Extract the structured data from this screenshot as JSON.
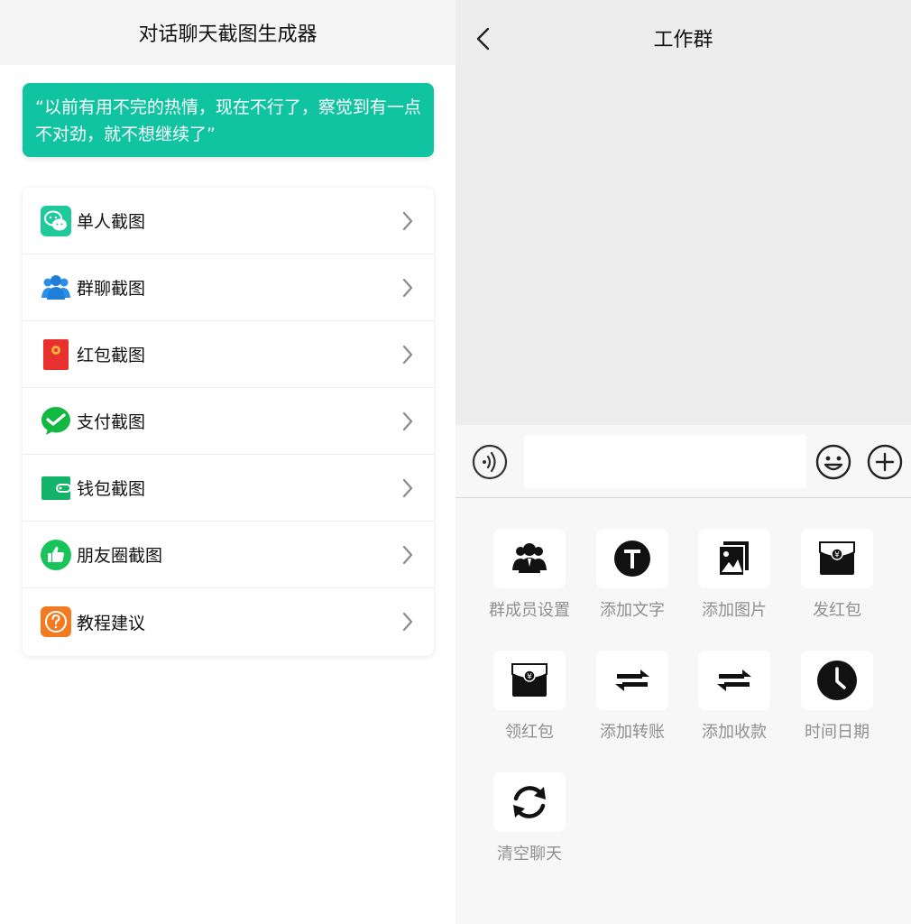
{
  "left": {
    "title": "对话聊天截图生成器",
    "quote": "“以前有用不完的热情，现在不行了，察觉到有一点不对劲，就不想继续了”",
    "menu": [
      {
        "label": "单人截图",
        "icon": "wechat-icon",
        "color": "#1ec99a"
      },
      {
        "label": "群聊截图",
        "icon": "group-icon",
        "color": "#2b8ee8"
      },
      {
        "label": "红包截图",
        "icon": "red-packet-icon",
        "color": "#e8302f"
      },
      {
        "label": "支付截图",
        "icon": "payment-check-icon",
        "color": "#13b843"
      },
      {
        "label": "钱包截图",
        "icon": "wallet-icon",
        "color": "#13b36a"
      },
      {
        "label": "朋友圈截图",
        "icon": "thumbs-up-icon",
        "color": "#18c45a"
      },
      {
        "label": "教程建议",
        "icon": "question-icon",
        "color": "#f47a22"
      }
    ]
  },
  "right": {
    "title": "工作群",
    "input_value": "",
    "tools": [
      {
        "label": "群成员设置",
        "icon": "group-members-icon"
      },
      {
        "label": "添加文字",
        "icon": "text-t-icon"
      },
      {
        "label": "添加图片",
        "icon": "image-icon"
      },
      {
        "label": "发红包",
        "icon": "send-red-packet-icon"
      },
      {
        "label": "领红包",
        "icon": "receive-red-packet-icon"
      },
      {
        "label": "添加转账",
        "icon": "transfer-icon"
      },
      {
        "label": "添加收款",
        "icon": "receive-payment-icon"
      },
      {
        "label": "时间日期",
        "icon": "clock-icon"
      },
      {
        "label": "清空聊天",
        "icon": "refresh-icon"
      }
    ]
  },
  "colors": {
    "accent": "#10c4a1",
    "panel_bg": "#ededed"
  }
}
